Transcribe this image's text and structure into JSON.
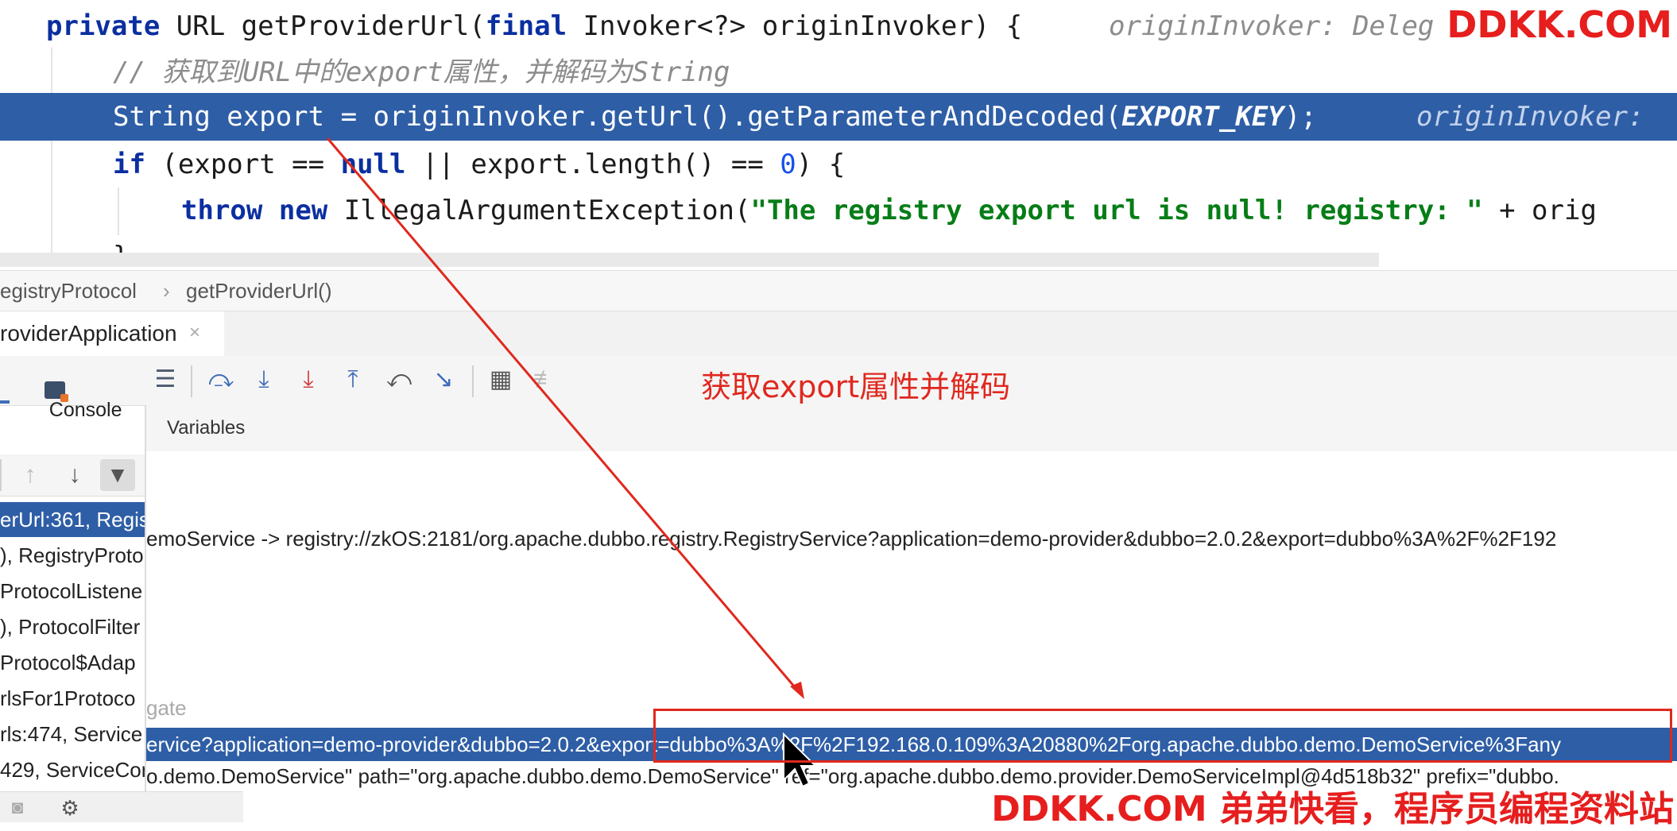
{
  "editor": {
    "line1": {
      "kw_private": "private",
      "t1": " URL getProviderUrl(",
      "kw_final": "final",
      "t2": " Invoker<?> originInvoker) {",
      "hint": "originInvoker: Deleg"
    },
    "line2_comment": "// 获取到URL中的export属性，并解码为String",
    "line3": {
      "t1": "String export = originInvoker.getUrl().getParameterAndDecoded(",
      "const": "EXPORT_KEY",
      "t2": ");",
      "hint": "originInvoker: "
    },
    "line4": {
      "kw_if": "if",
      "t1": " (export == ",
      "kw_null": "null",
      "t2": " || export.length() == ",
      "num": "0",
      "t3": ") {"
    },
    "line5": {
      "kw_throw": "throw",
      "kw_new": "new",
      "t1": " IllegalArgumentException(",
      "str": "\"The registry export url is null! registry: \"",
      "t2": " + orig"
    },
    "line6": "}"
  },
  "breadcrumb": {
    "item1": "egistryProtocol",
    "sep": "›",
    "item2": "getProviderUrl()"
  },
  "debug": {
    "tab_label": "roviderApplication",
    "tab_close": "×",
    "console_label": "Console",
    "variables_label": "Variables"
  },
  "toolbar_icons": [
    "console-icon",
    "menu-icon",
    "step-over-icon",
    "step-into-icon",
    "force-step-into-icon",
    "step-out-icon",
    "drop-frame-icon",
    "run-to-cursor-icon",
    "evaluate-icon",
    "trace-icon"
  ],
  "frames": [
    {
      "label": "erUrl:361, Regis",
      "selected": true
    },
    {
      "label": "), RegistryProto",
      "selected": false
    },
    {
      "label": "ProtocolListene",
      "selected": false
    },
    {
      "label": "), ProtocolFilter",
      "selected": false
    },
    {
      "label": "Protocol$Adap",
      "selected": false
    },
    {
      "label": "rlsFor1Protoco",
      "selected": false
    },
    {
      "label": "rls:474, Service",
      "selected": false
    },
    {
      "label": "429, ServiceCon",
      "selected": false
    }
  ],
  "variables": {
    "row1": "emoService -> registry://zkOS:2181/org.apache.dubbo.registry.RegistryService?application=demo-provider&dubbo=2.0.2&export=dubbo%3A%2F%2F192",
    "row_gate": "gate",
    "row_selected": "ervice?application=demo-provider&dubbo=2.0.2&export=dubbo%3A%2F%2F192.168.0.109%3A20880%2Forg.apache.dubbo.demo.DemoService%3Fany",
    "row_last": "o.demo.DemoService\" path=\"org.apache.dubbo.demo.DemoService\" ref=\"org.apache.dubbo.demo.provider.DemoServiceImpl@4d518b32\" prefix=\"dubbo."
  },
  "annotation": {
    "text": "获取export属性并解码",
    "color": "#e0281e"
  },
  "watermark": {
    "top": "DDKK.COM",
    "bottom": "DDKK.COM 弟弟快看，程序员编程资料站"
  },
  "colors": {
    "selection": "#2e5ea6",
    "keyword": "#0b2fa0",
    "string": "#067d17",
    "comment": "#8c8c8c",
    "constant": "#871094",
    "number": "#1750eb",
    "watermark": "#e61e1e"
  }
}
